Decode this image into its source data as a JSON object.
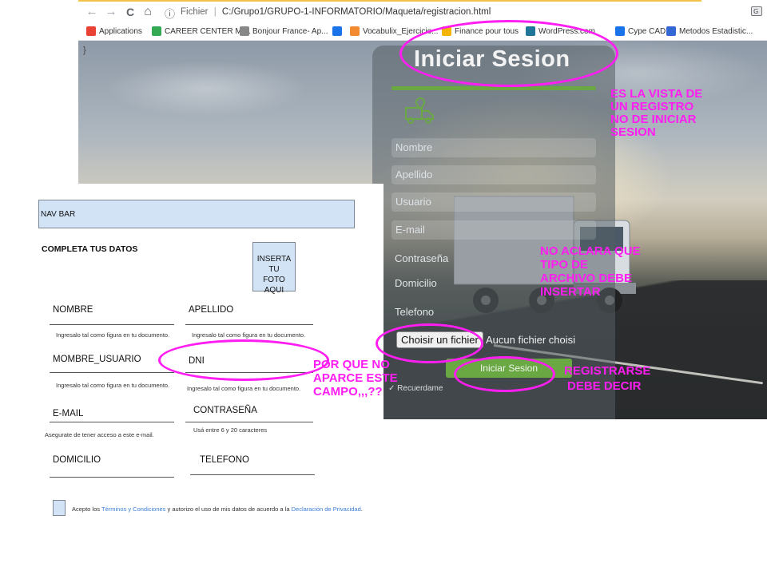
{
  "browser": {
    "nav_back": "←",
    "nav_forward": "→",
    "nav_reload": "C",
    "nav_home": "⌂",
    "info_icon": "ⓘ",
    "url_label": "Fichier",
    "url_separator": "|",
    "url_path": "C:/Grupo1/GRUPO-1-INFORMATORIO/Maqueta/registracion.html",
    "bookmarks": [
      {
        "label": "Applications",
        "icon": "apps-grid-icon",
        "color": "#e94235"
      },
      {
        "label": "CAREER CENTER MI...",
        "icon": "career-center-icon",
        "color": "#34a853"
      },
      {
        "label": "Bonjour France- Ap...",
        "icon": "bonjour-france-icon",
        "color": "#888888"
      },
      {
        "label": "",
        "icon": "trello-icon",
        "color": "#1a73e8"
      },
      {
        "label": "Vocabulix_Ejercicio...",
        "icon": "vocabulix-icon",
        "color": "#f28b30"
      },
      {
        "label": "Finance pour tous",
        "icon": "finance-icon",
        "color": "#f5b400"
      },
      {
        "label": "WordPress.com",
        "icon": "wordpress-icon",
        "color": "#21759b"
      },
      {
        "label": "Cype CAD",
        "icon": "cype-icon",
        "color": "#1a73e8"
      },
      {
        "label": "Metodos Estadistic...",
        "icon": "metodos-icon",
        "color": "#3367d6"
      }
    ]
  },
  "page": {
    "stray_text": "}",
    "title": "Iniciar Sesion",
    "fields": [
      "Nombre",
      "Apellido",
      "Usuario",
      "E-mail"
    ],
    "labels": [
      "Contraseña",
      "Domicilio",
      "Telefono"
    ],
    "file_button": "Choisir un fichier",
    "file_status": "Aucun fichier choisi",
    "submit": "Iniciar Sesion",
    "remember": "Recuerdame",
    "accent_color": "#6aa844"
  },
  "wireframe": {
    "nav": "NAV BAR",
    "title": "COMPLETA TUS DATOS",
    "photo_line1": "INSERTA TU",
    "photo_line2": "FOTO AQUI",
    "nombre": "NOMBRE",
    "apellido": "APELLIDO",
    "hint_doc": "Ingresalo tal como figura en tu documento.",
    "usuario": "MOMBRE_USUARIO",
    "dni": "DNI",
    "email": "E-MAIL",
    "contrasena": "CONTRASEÑA",
    "hint_email": "Asegurate de tener acceso a este e-mail.",
    "hint_pass": "Usá entre 6 y 20 caracteres",
    "domicilio": "DOMICILIO",
    "telefono": "TELEFONO",
    "terms_pre": "Acepto los ",
    "terms_link1": "Términos y Condiciones",
    "terms_mid": " y autorizo el uso de mis datos de acuerdo a la ",
    "terms_link2": "Declaración de Privacidad",
    "terms_end": "."
  },
  "annotations": {
    "registro": [
      "ES LA VISTA DE",
      "UN REGISTRO",
      "NO DE INICIAR",
      "SESION"
    ],
    "archivo": [
      "NO ACLARA QUE",
      "TIPO DE",
      "ARCHIVO DEBE",
      "INSERTAR"
    ],
    "dni": [
      "POR QUE NO",
      "APARCE ESTE",
      "CAMPO,,,??"
    ],
    "boton": [
      "REGISTRARSE",
      "DEBE DECIR"
    ],
    "color": "#ff1df2"
  }
}
